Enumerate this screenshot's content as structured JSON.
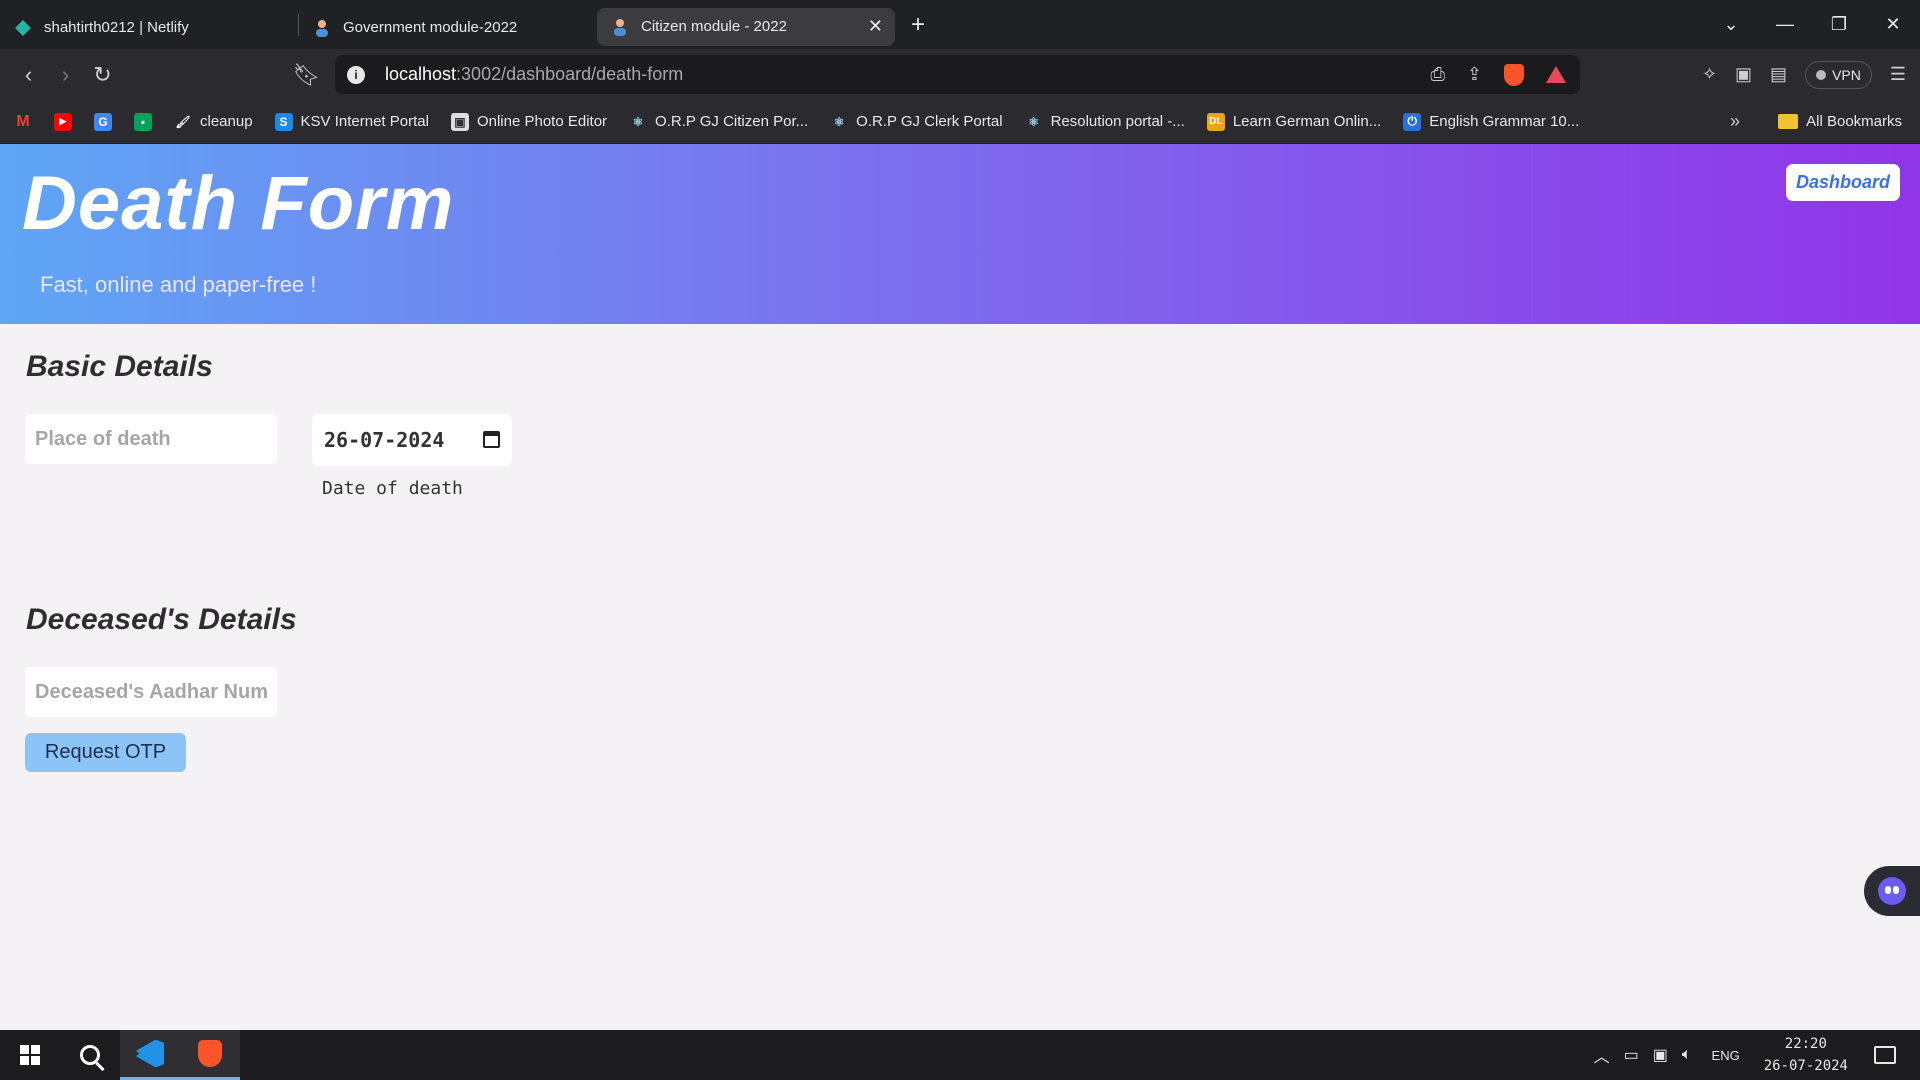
{
  "browser": {
    "tabs": [
      {
        "label": "shahtirth0212 | Netlify",
        "icon": "netlify-icon",
        "active": false
      },
      {
        "label": "Government module-2022",
        "icon": "user-icon",
        "active": false
      },
      {
        "label": "Citizen module - 2022",
        "icon": "user-icon",
        "active": true
      }
    ],
    "url_host": "localhost",
    "url_rest": ":3002/dashboard/death-form",
    "vpn_label": "VPN",
    "bookmarks": [
      {
        "label": "",
        "icon": "gmail-icon"
      },
      {
        "label": "",
        "icon": "youtube-icon"
      },
      {
        "label": "",
        "icon": "google-translate-icon"
      },
      {
        "label": "",
        "icon": "meet-icon"
      },
      {
        "label": "cleanup",
        "icon": "cleanup-icon"
      },
      {
        "label": "KSV Internet Portal",
        "icon": "ksv-icon"
      },
      {
        "label": "Online Photo Editor",
        "icon": "photo-editor-icon"
      },
      {
        "label": "O.R.P GJ Citizen Por...",
        "icon": "react-icon"
      },
      {
        "label": "O.R.P GJ Clerk Portal",
        "icon": "react-icon"
      },
      {
        "label": "Resolution portal -...",
        "icon": "react-icon"
      },
      {
        "label": "Learn German Onlin...",
        "icon": "dl-icon"
      },
      {
        "label": "English Grammar 10...",
        "icon": "power-icon"
      }
    ],
    "all_bookmarks": "All Bookmarks"
  },
  "page": {
    "title": "Death Form",
    "subtitle": "Fast, online and paper-free !",
    "dashboard_button": "Dashboard",
    "basic_details": {
      "heading": "Basic Details",
      "place_placeholder": "Place of death",
      "date_value": "26-07-2024",
      "date_label": "Date of death"
    },
    "deceased_details": {
      "heading": "Deceased's Details",
      "aadhar_placeholder": "Deceased's Aadhar Number",
      "otp_button": "Request OTP"
    }
  },
  "taskbar": {
    "lang": "ENG",
    "time": "22:20",
    "date": "26-07-2024"
  },
  "colors": {
    "hero_gradient": [
      "#5fa6f5",
      "#7c70ee",
      "#9035e8"
    ],
    "otp_button": "#8dc4f7",
    "dashboard_text": "#3b6fe6"
  }
}
